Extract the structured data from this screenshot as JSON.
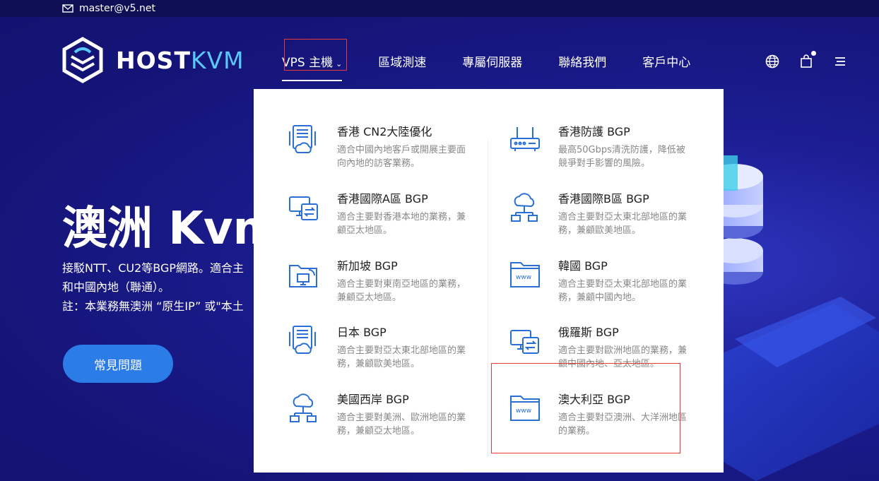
{
  "topbar": {
    "email": "master@v5.net"
  },
  "logo": {
    "host": "HOST",
    "kvm": "KVM"
  },
  "nav": [
    {
      "label": "VPS 主機",
      "chevron": "⌄"
    },
    {
      "label": "區域測速"
    },
    {
      "label": "專屬伺服器"
    },
    {
      "label": "聯絡我們"
    },
    {
      "label": "客戶中心"
    }
  ],
  "icons": [
    "globe-icon",
    "cart-icon",
    "menu-icon"
  ],
  "hero": {
    "title": "澳洲 Kvm",
    "desc_line1": "接駁NTT、CU2等BGP網路。適合主",
    "desc_line2": "和中國內地（聯通）。",
    "desc_line3": "註：本業務無澳洲 “原生IP” 或\"本土",
    "faq_label": "常見問題"
  },
  "dropdown": {
    "items": [
      {
        "title": "香港 CN2大陸優化",
        "desc": "適合中國內地客戶或開展主要面向內地的訪客業務。",
        "icon": "server-cloud-icon"
      },
      {
        "title": "香港防護 BGP",
        "desc": "最高50Gbps清洗防護，降低被競爭對手影響的風險。",
        "icon": "router-icon"
      },
      {
        "title": "香港國際A區 BGP",
        "desc": "適合主要對香港本地的業務，兼顧亞太地區。",
        "icon": "monitor-sync-icon"
      },
      {
        "title": "香港國際B區 BGP",
        "desc": "適合主要對亞太東北部地區的業務，兼顧歐美地區。",
        "icon": "cloud-network-icon"
      },
      {
        "title": "新加坡 BGP",
        "desc": "適合主要對東南亞地區的業務，兼顧亞太地區。",
        "icon": "folder-network-icon"
      },
      {
        "title": "韓國 BGP",
        "desc": "適合主要對亞太東北部地區的業務，兼顧中國內地。",
        "icon": "folder-www-icon"
      },
      {
        "title": "日本 BGP",
        "desc": "適合主要對亞太東北部地區的業務，兼顧歐美地區。",
        "icon": "server-cloud-icon"
      },
      {
        "title": "俄羅斯 BGP",
        "desc": "適合主要對歐洲地區的業務，兼顧中國內地、亞太地區。",
        "icon": "monitor-sync-icon"
      },
      {
        "title": "美國西岸 BGP",
        "desc": "適合主要對美洲、歐洲地區的業務，兼顧亞太地區。",
        "icon": "cloud-network-icon"
      },
      {
        "title": "澳大利亞 BGP",
        "desc": "適合主要對亞澳洲、大洋洲地區的業務。",
        "icon": "folder-www-icon"
      }
    ]
  },
  "colors": {
    "accent": "#2c7ce8",
    "icon": "#2a6fd6",
    "highlight": "#e53935"
  }
}
